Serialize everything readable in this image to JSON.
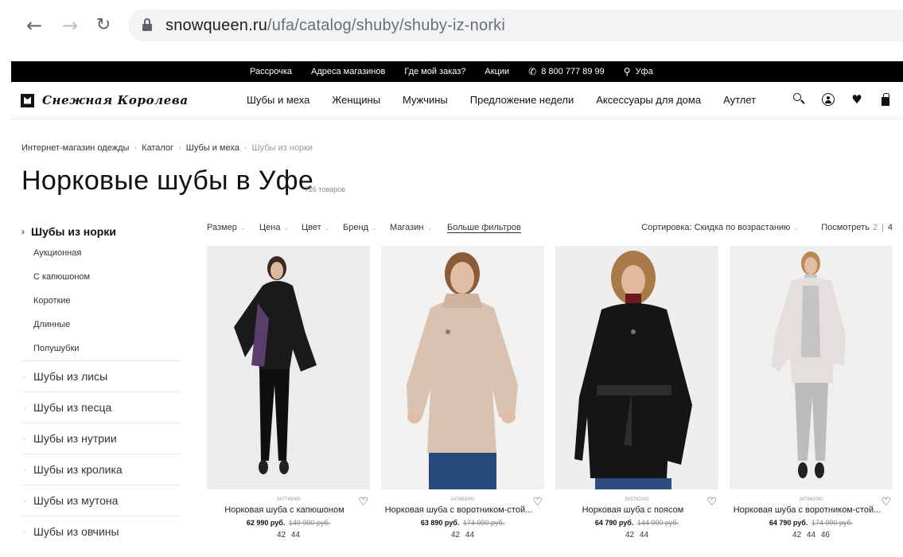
{
  "browser": {
    "url_host": "snowqueen.ru",
    "url_path": "/ufa/catalog/shuby/shuby-iz-norki"
  },
  "topbar": {
    "items": [
      {
        "label": "Рассрочка"
      },
      {
        "label": "Адреса магазинов"
      },
      {
        "label": "Где мой заказ?"
      },
      {
        "label": "Акции"
      },
      {
        "label": "8 800 777 89 99",
        "icon": "phone-icon"
      },
      {
        "label": "Уфа",
        "icon": "location-pin-icon"
      }
    ]
  },
  "header": {
    "logo_text": "Снежная Королева",
    "nav": [
      "Шубы и меха",
      "Женщины",
      "Мужчины",
      "Предложение недели",
      "Аксессуары для дома",
      "Аутлет"
    ]
  },
  "breadcrumb": [
    "Интернет-магазин одежды",
    "Каталог",
    "Шубы и меха",
    "Шубы из норки"
  ],
  "page": {
    "title": "Норковые шубы в Уфе",
    "count": "726 товаров"
  },
  "sidebar": {
    "active": "Шубы из норки",
    "subitems": [
      "Аукционная",
      "С капюшоном",
      "Короткие",
      "Длинные",
      "Полушубки"
    ],
    "categories": [
      "Шубы из лисы",
      "Шубы из песца",
      "Шубы из нутрии",
      "Шубы из кролика",
      "Шубы из мутона",
      "Шубы из овчины"
    ]
  },
  "filters": {
    "items": [
      "Размер",
      "Цена",
      "Цвет",
      "Бренд",
      "Магазин"
    ],
    "more": "Больше фильтров",
    "sort": "Сортировка: Скидка по возрастанию",
    "view_label": "Посмотреть",
    "view_opt1": "2",
    "view_sep": "|",
    "view_opt2": "4"
  },
  "products": [
    {
      "sku": "247748000",
      "name": "Норковая шуба с капюшоном",
      "price": "62 990 руб.",
      "old_price": "149 990 руб.",
      "sizes": "42 44",
      "coat_color": "#1a1a1c"
    },
    {
      "sku": "247863000",
      "name": "Норковая шуба с воротником-стой...",
      "price": "63 890 руб.",
      "old_price": "174 990 руб.",
      "sizes": "42 44",
      "coat_color": "#d9c2b0"
    },
    {
      "sku": "503792003",
      "name": "Норковая шуба с поясом",
      "price": "64 790 руб.",
      "old_price": "144 990 руб.",
      "sizes": "42 44",
      "coat_color": "#151517"
    },
    {
      "sku": "247862000",
      "name": "Норковая шуба с воротником-стой...",
      "price": "64 790 руб.",
      "old_price": "174 990 руб.",
      "sizes": "42 44 46",
      "coat_color": "#e4dfdc"
    }
  ]
}
